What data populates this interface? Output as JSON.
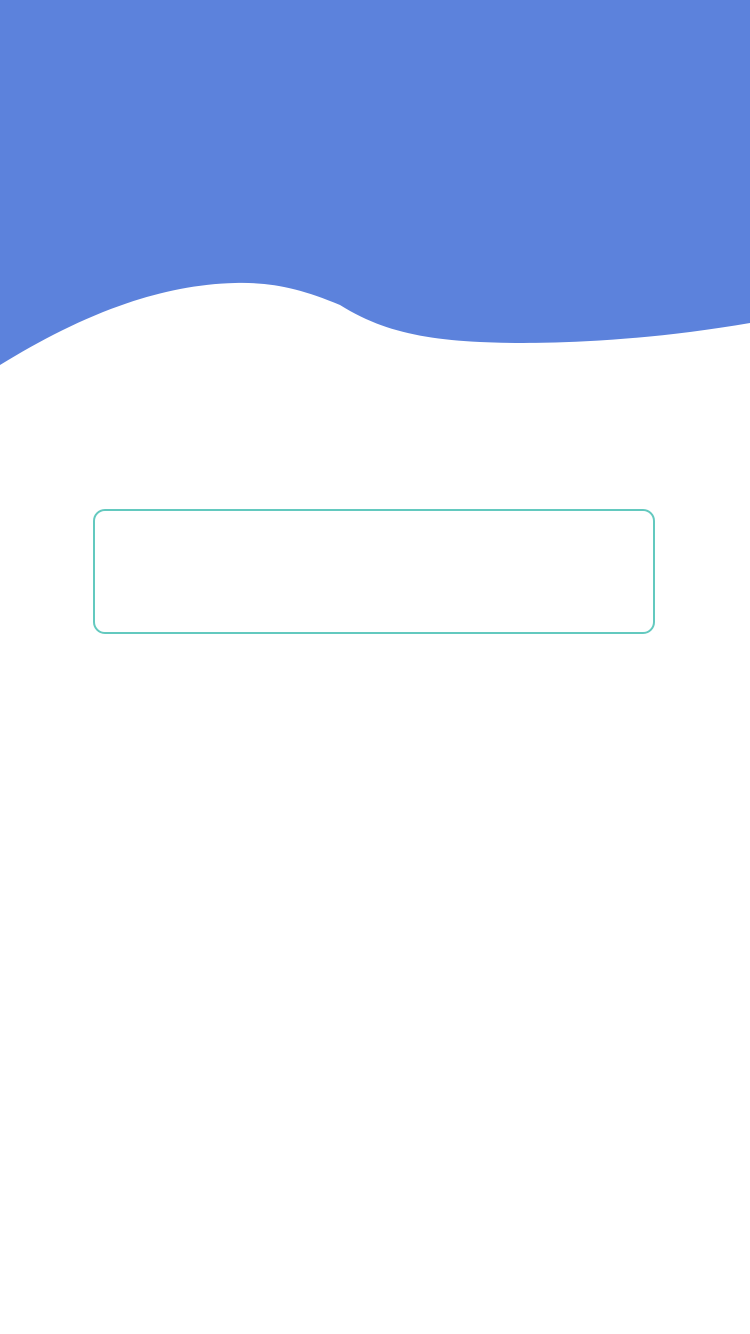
{
  "header": {
    "background_color": "#5c82dc"
  },
  "input": {
    "value": "",
    "placeholder": "",
    "border_color": "#63c9bf"
  }
}
